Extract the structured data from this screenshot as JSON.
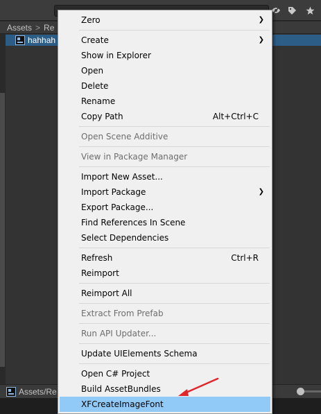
{
  "project": {
    "breadcrumb": [
      "Assets",
      "Re"
    ],
    "selected_asset": "hahhah",
    "status_path": "Assets/Re"
  },
  "icons": {
    "toolbar": [
      "eye-slash-icon",
      "tag-icon",
      "star-icon"
    ],
    "file": "image-file-icon",
    "submenu": "chevron-right-icon"
  },
  "context_menu": {
    "items": [
      {
        "label": "Zero",
        "submenu": true
      },
      {
        "separator": true
      },
      {
        "label": "Create",
        "submenu": true
      },
      {
        "label": "Show in Explorer"
      },
      {
        "label": "Open"
      },
      {
        "label": "Delete"
      },
      {
        "label": "Rename"
      },
      {
        "label": "Copy Path",
        "shortcut": "Alt+Ctrl+C"
      },
      {
        "separator": true
      },
      {
        "label": "Open Scene Additive",
        "disabled": true
      },
      {
        "separator": true
      },
      {
        "label": "View in Package Manager",
        "disabled": true
      },
      {
        "separator": true
      },
      {
        "label": "Import New Asset..."
      },
      {
        "label": "Import Package",
        "submenu": true
      },
      {
        "label": "Export Package..."
      },
      {
        "label": "Find References In Scene"
      },
      {
        "label": "Select Dependencies"
      },
      {
        "separator": true
      },
      {
        "label": "Refresh",
        "shortcut": "Ctrl+R"
      },
      {
        "label": "Reimport"
      },
      {
        "separator": true
      },
      {
        "label": "Reimport All"
      },
      {
        "separator": true
      },
      {
        "label": "Extract From Prefab",
        "disabled": true
      },
      {
        "separator": true
      },
      {
        "label": "Run API Updater...",
        "disabled": true
      },
      {
        "separator": true
      },
      {
        "label": "Update UIElements Schema"
      },
      {
        "separator": true
      },
      {
        "label": "Open C# Project"
      },
      {
        "label": "Build AssetBundles"
      },
      {
        "label": "XFCreateImageFont",
        "highlighted": true
      }
    ]
  },
  "colors": {
    "menu_background": "#f0f0f0",
    "menu_highlight": "#91c9f7",
    "selection": "#2c5d87",
    "annotation_arrow": "#e0262b"
  }
}
